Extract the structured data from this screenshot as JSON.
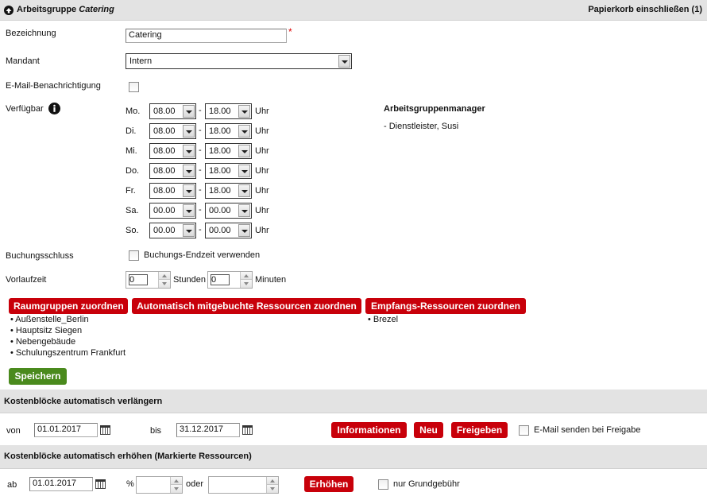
{
  "header": {
    "title_prefix": "Arbeitsgruppe",
    "title_name": "Catering",
    "trash_label": "Papierkorb einschließen (1)"
  },
  "form": {
    "bezeichnung_label": "Bezeichnung",
    "bezeichnung_value": "Catering",
    "required_mark": "*",
    "mandant_label": "Mandant",
    "mandant_value": "Intern",
    "email_label": "E-Mail-Benachrichtigung",
    "verfuegbar_label": "Verfügbar",
    "uhr_label": "Uhr",
    "dash": "-",
    "days": [
      {
        "day": "Mo.",
        "from": "08.00",
        "to": "18.00"
      },
      {
        "day": "Di.",
        "from": "08.00",
        "to": "18.00"
      },
      {
        "day": "Mi.",
        "from": "08.00",
        "to": "18.00"
      },
      {
        "day": "Do.",
        "from": "08.00",
        "to": "18.00"
      },
      {
        "day": "Fr.",
        "from": "08.00",
        "to": "18.00"
      },
      {
        "day": "Sa.",
        "from": "00.00",
        "to": "00.00"
      },
      {
        "day": "So.",
        "from": "00.00",
        "to": "00.00"
      }
    ],
    "manager_title": "Arbeitsgruppenmanager",
    "manager_entry": "- Dienstleister, Susi",
    "buchungsschluss_label": "Buchungsschluss",
    "buchungs_endzeit_label": "Buchungs-Endzeit verwenden",
    "vorlaufzeit_label": "Vorlaufzeit",
    "stunden_value": "0",
    "stunden_label": "Stunden",
    "minuten_value": "0",
    "minuten_label": "Minuten"
  },
  "assign": {
    "raumgruppen_button": "Raumgruppen zuordnen",
    "auto_button": "Automatisch mitgebuchte Ressourcen zuordnen",
    "empfang_button": "Empfangs-Ressourcen zuordnen",
    "raumgruppen": [
      "• Außenstelle_Berlin",
      "• Hauptsitz Siegen",
      "• Nebengebäude",
      "• Schulungszentrum Frankfurt"
    ],
    "empfang": [
      "• Brezel"
    ],
    "save_button": "Speichern"
  },
  "extend": {
    "title": "Kostenblöcke automatisch verlängern",
    "von_label": "von",
    "von_value": "01.01.2017",
    "bis_label": "bis",
    "bis_value": "31.12.2017",
    "info_button": "Informationen",
    "new_button": "Neu",
    "release_button": "Freigeben",
    "email_release_label": "E-Mail senden bei Freigabe"
  },
  "increase": {
    "title": "Kostenblöcke automatisch erhöhen (Markierte Ressourcen)",
    "ab_label": "ab",
    "ab_value": "01.01.2017",
    "percent_label": "%",
    "oder_label": "oder",
    "percent_value": "",
    "amount_value": "",
    "raise_button": "Erhöhen",
    "base_fee_label": "nur Grundgebühr"
  },
  "colors": {
    "red_button": "#c8000a",
    "green_button": "#4a8a1d",
    "section_bg": "#e3e3e3"
  }
}
